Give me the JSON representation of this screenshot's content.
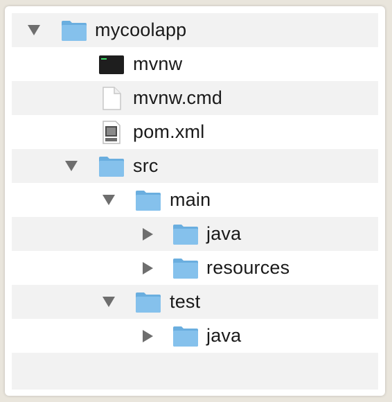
{
  "tree": {
    "items": [
      {
        "label": "mycoolapp",
        "icon": "folder-icon",
        "state": "expanded"
      },
      {
        "label": "mvnw",
        "icon": "terminal-executable-icon"
      },
      {
        "label": "mvnw.cmd",
        "icon": "document-icon"
      },
      {
        "label": "pom.xml",
        "icon": "xml-file-icon"
      },
      {
        "label": "src",
        "icon": "folder-icon",
        "state": "expanded"
      },
      {
        "label": "main",
        "icon": "folder-icon",
        "state": "expanded"
      },
      {
        "label": "java",
        "icon": "folder-icon",
        "state": "collapsed"
      },
      {
        "label": "resources",
        "icon": "folder-icon",
        "state": "collapsed"
      },
      {
        "label": "test",
        "icon": "folder-icon",
        "state": "expanded"
      },
      {
        "label": "java",
        "icon": "folder-icon",
        "state": "collapsed"
      }
    ]
  },
  "colors": {
    "folder": "#7fbcea",
    "folder_tab": "#6aaedf",
    "row_alternate": "#f2f2f2",
    "disclosure": "#6e6e6e"
  }
}
